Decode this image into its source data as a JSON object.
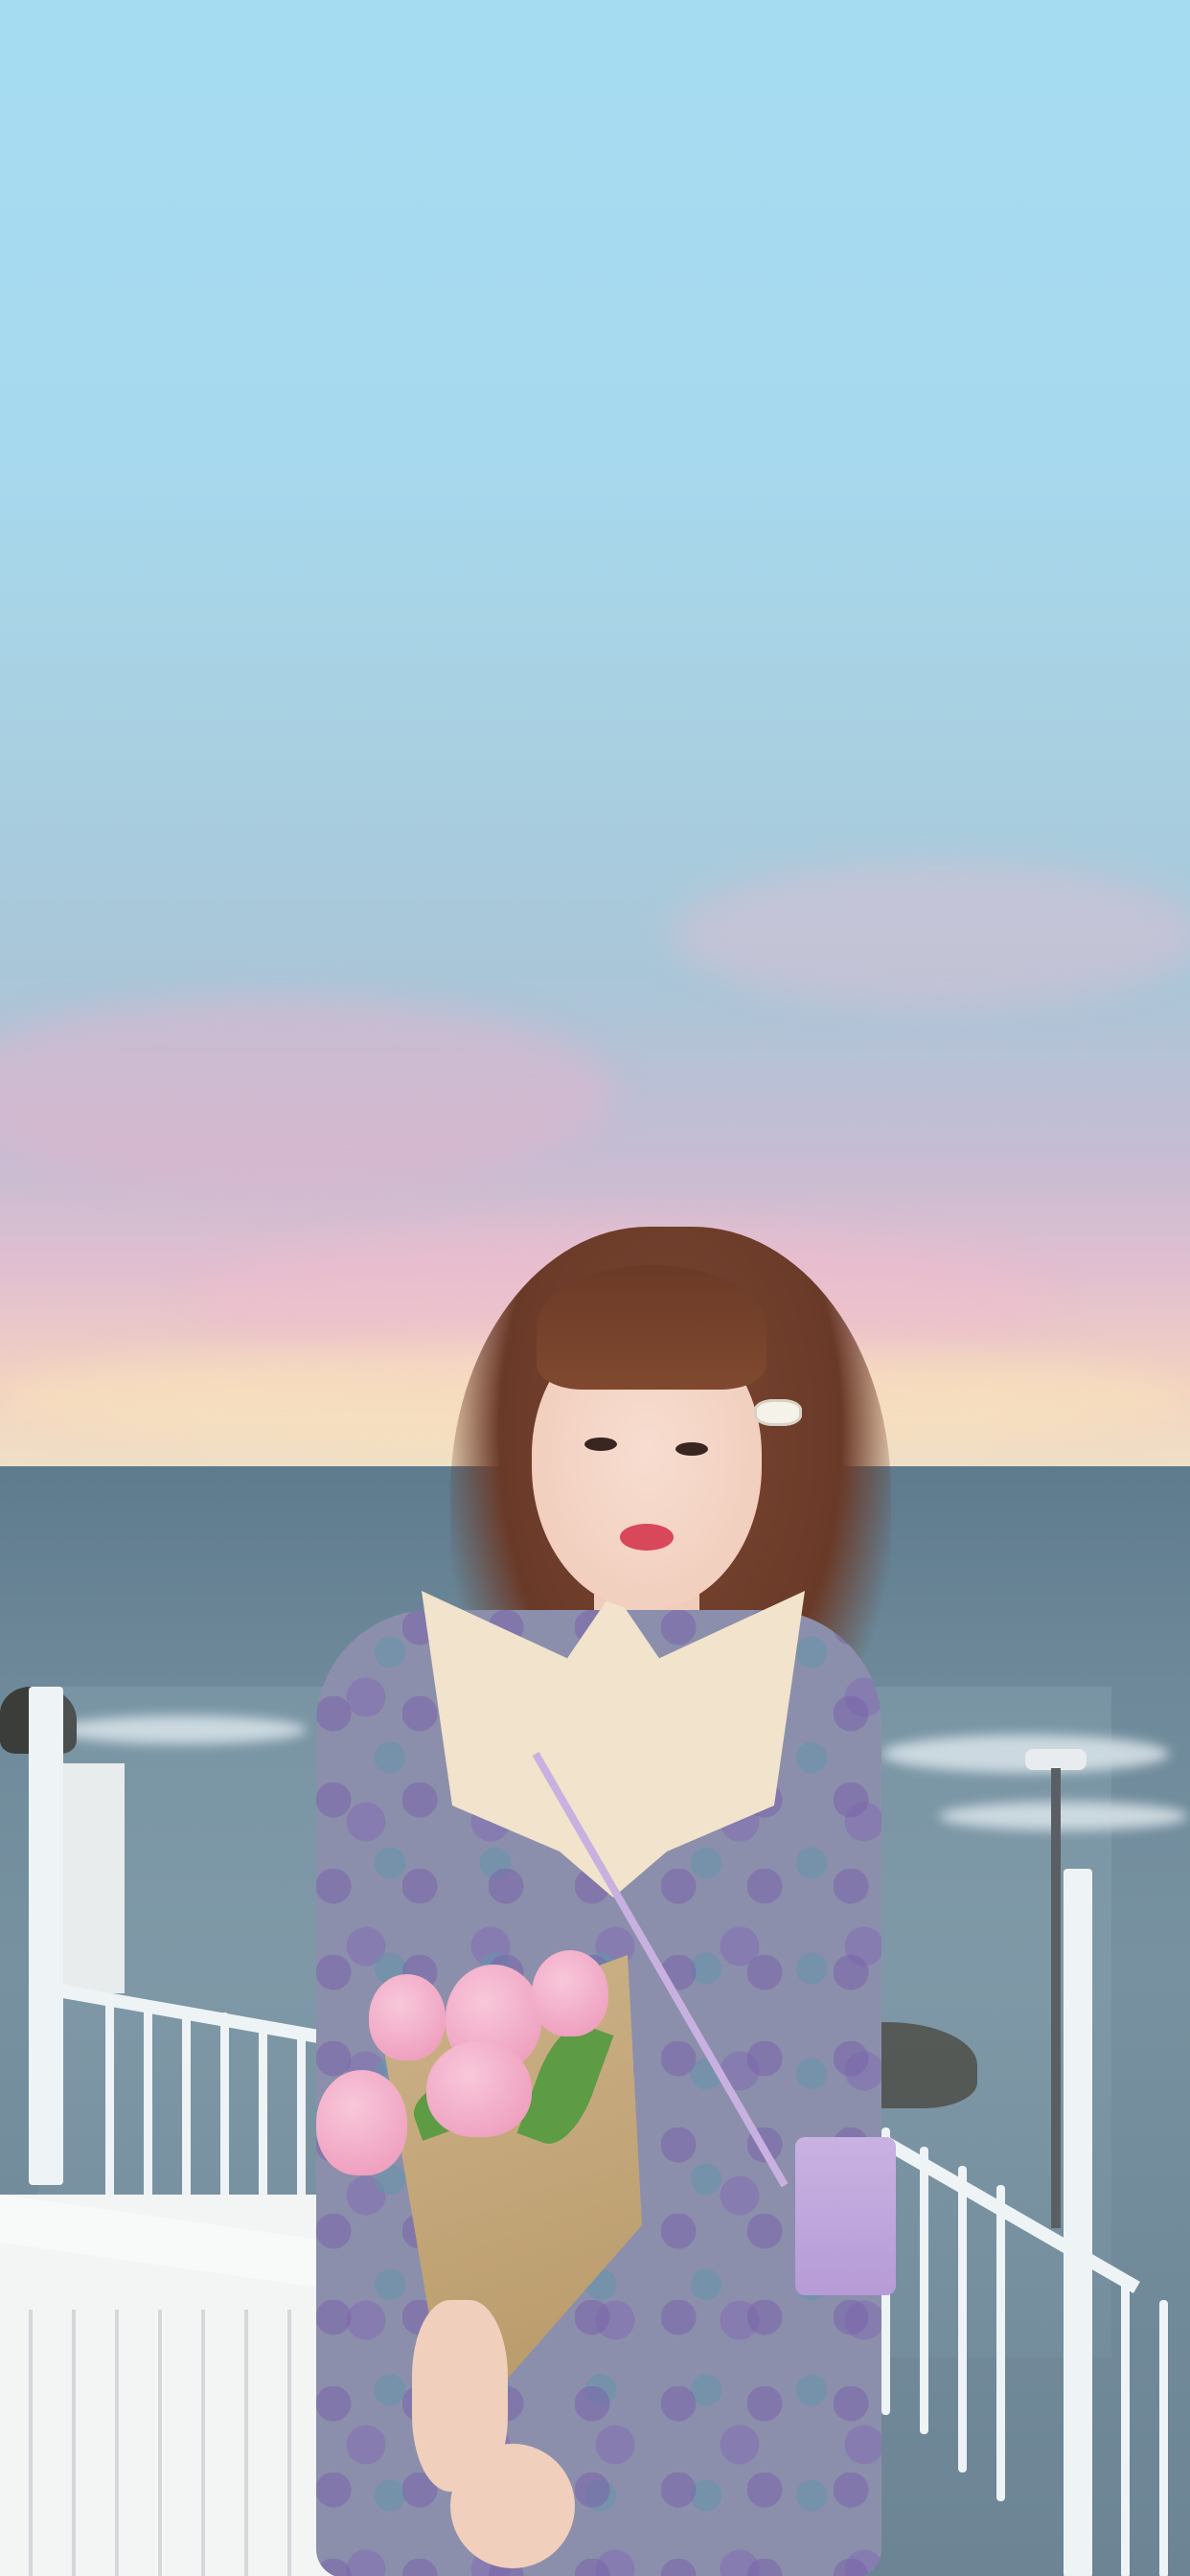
{
  "scene": {
    "type": "photograph",
    "description_id": "portrait-by-sea"
  },
  "colors": {
    "sky_top": "#a6dcf2",
    "sky_horizon": "#eee2c8",
    "sea": "#6e8a9a",
    "railing": "#eef3f5",
    "hair": "#6a3a28",
    "dress": "#8c8fab",
    "collar": "#f1e3cc",
    "tulip": "#ec96b8",
    "bag": "#b69bd6"
  }
}
